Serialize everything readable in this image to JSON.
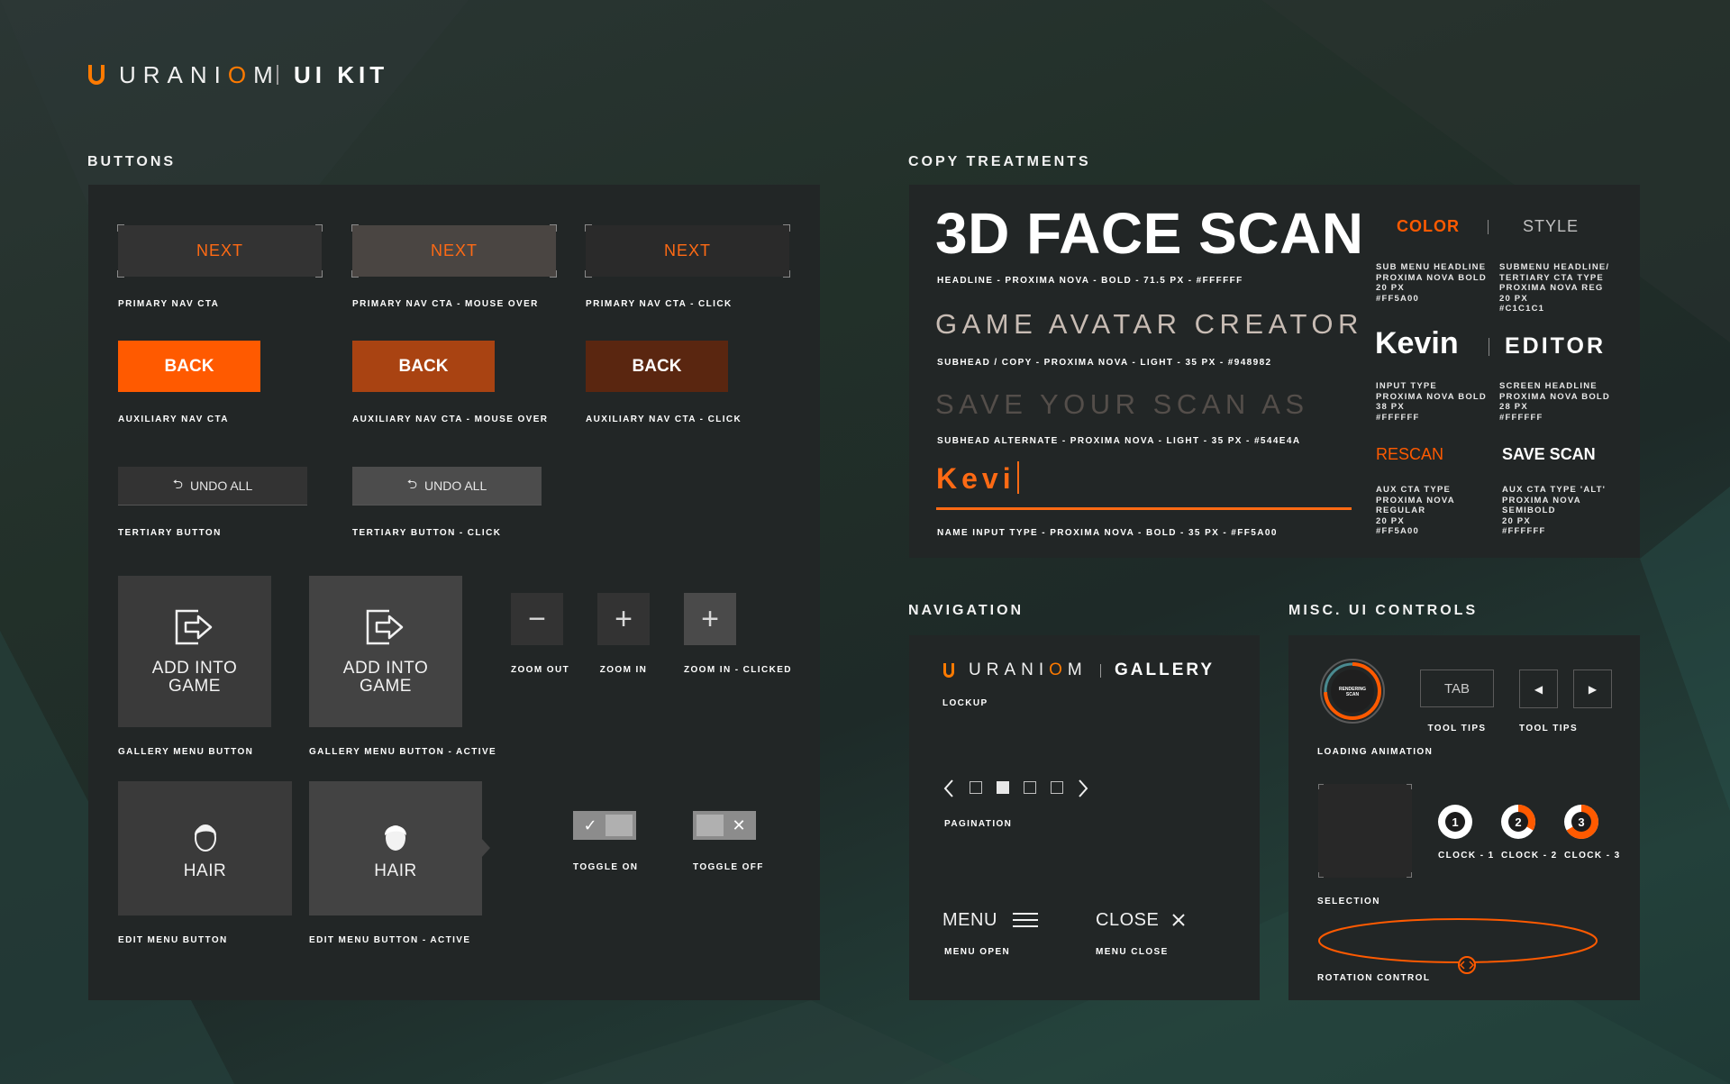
{
  "header": {
    "brand_word_pre": "URANI",
    "brand_word_o": "O",
    "brand_word_post": "M",
    "kit_label": "UI KIT"
  },
  "colors": {
    "accent": "#FF5A00",
    "panel": "#222626",
    "background": "#1E2A28"
  },
  "buttons": {
    "title": "BUTTONS",
    "nav_cta": [
      {
        "label": "NEXT",
        "caption": "PRIMARY NAV CTA"
      },
      {
        "label": "NEXT",
        "caption": "PRIMARY NAV CTA - MOUSE OVER"
      },
      {
        "label": "NEXT",
        "caption": "PRIMARY NAV CTA - CLICK"
      }
    ],
    "aux_cta": [
      {
        "label": "BACK",
        "caption": "AUXILIARY NAV CTA"
      },
      {
        "label": "BACK",
        "caption": "AUXILIARY NAV CTA - MOUSE OVER"
      },
      {
        "label": "BACK",
        "caption": "AUXILIARY NAV CTA - CLICK"
      }
    ],
    "tertiary": [
      {
        "label": "UNDO ALL",
        "caption": "TERTIARY BUTTON",
        "icon": "undo-icon"
      },
      {
        "label": "UNDO ALL",
        "caption": "TERTIARY BUTTON - CLICK",
        "icon": "undo-icon"
      }
    ],
    "gallery": [
      {
        "label_line1": "ADD INTO",
        "label_line2": "GAME",
        "caption": "GALLERY MENU BUTTON",
        "icon": "add-into-game-icon"
      },
      {
        "label_line1": "ADD INTO",
        "label_line2": "GAME",
        "caption": "GALLERY  MENU BUTTON - ACTIVE",
        "icon": "add-into-game-icon"
      }
    ],
    "zoom": [
      {
        "glyph": "−",
        "caption": "ZOOM OUT"
      },
      {
        "glyph": "+",
        "caption": "ZOOM IN"
      },
      {
        "glyph": "+",
        "caption": "ZOOM IN - CLICKED"
      }
    ],
    "edit": [
      {
        "label": "HAIR",
        "caption": "EDIT MENU BUTTON",
        "icon": "hair-icon"
      },
      {
        "label": "HAIR",
        "caption": "EDIT  MENU BUTTON - ACTIVE",
        "icon": "hair-icon"
      }
    ],
    "toggles": [
      {
        "caption": "TOGGLE ON",
        "state": "on"
      },
      {
        "caption": "TOGGLE OFF",
        "state": "off"
      }
    ]
  },
  "copy": {
    "title": "COPY TREATMENTS",
    "headline": "3D FACE SCAN",
    "headline_spec": "HEADLINE - PROXIMA NOVA - BOLD - 71.5 PX - #FFFFFF",
    "subhead": "GAME AVATAR CREATOR",
    "subhead_spec": "SUBHEAD / COPY - PROXIMA NOVA - LIGHT - 35 PX - #948982",
    "subhead_alt": "SAVE YOUR SCAN AS",
    "subhead_alt_spec": "SUBHEAD ALTERNATE - PROXIMA NOVA - LIGHT - 35 PX - #544E4A",
    "name_input": "Kevi",
    "name_input_spec": "NAME INPUT TYPE - PROXIMA NOVA - BOLD - 35 PX - #FF5A00",
    "color_tab": "COLOR",
    "style_tab": "STYLE",
    "sub_menu_spec": "SUB MENU HEADLINE\nPROXIMA NOVA BOLD\n20 PX\n#FF5A00",
    "submenu_tert_spec": "SUBMENU HEADLINE/\nTERTIARY CTA TYPE\nPROXIMA NOVA REG\n20 PX\n#C1C1C1",
    "input_sample": "Kevin",
    "editor_sample": "EDITOR",
    "input_spec": "INPUT TYPE\nPROXIMA NOVA BOLD\n38 PX\n#FFFFFF",
    "screen_spec": "SCREEN HEADLINE\nPROXIMA NOVA BOLD\n28 PX\n#FFFFFF",
    "rescan": "RESCAN",
    "save_scan": "SAVE SCAN",
    "aux_spec": "AUX CTA TYPE\nPROXIMA NOVA\nREGULAR\n20 PX\n#FF5A00",
    "aux_alt_spec": "AUX CTA TYPE 'ALT'\nPROXIMA NOVA\nSEMIBOLD\n20 PX\n#FFFFFF"
  },
  "navigation": {
    "title": "NAVIGATION",
    "lockup_word_pre": "URANI",
    "lockup_word_o": "O",
    "lockup_word_post": "M",
    "lockup_gallery": "GALLERY",
    "lockup_caption": "LOCKUP",
    "pagination_caption": "PAGINATION",
    "pagination_active_index": 1,
    "menu_label": "MENU",
    "menu_caption": "MENU OPEN",
    "close_label": "CLOSE",
    "close_caption": "MENU CLOSE"
  },
  "misc": {
    "title": "MISC. UI CONTROLS",
    "loading_text_line1": "RENDERING",
    "loading_text_line2": "SCAN",
    "loading_caption": "LOADING ANIMATION",
    "tab_label": "TAB",
    "tooltips_caption_1": "TOOL TIPS",
    "tooltips_caption_2": "TOOL TIPS",
    "selection_caption": "SELECTION",
    "clocks": [
      {
        "num": "1",
        "caption": "CLOCK - 1",
        "progress": 0
      },
      {
        "num": "2",
        "caption": "CLOCK - 2",
        "progress": 0.33
      },
      {
        "num": "3",
        "caption": "CLOCK - 3",
        "progress": 0.66
      }
    ],
    "rotation_caption": "ROTATION CONTROL"
  }
}
